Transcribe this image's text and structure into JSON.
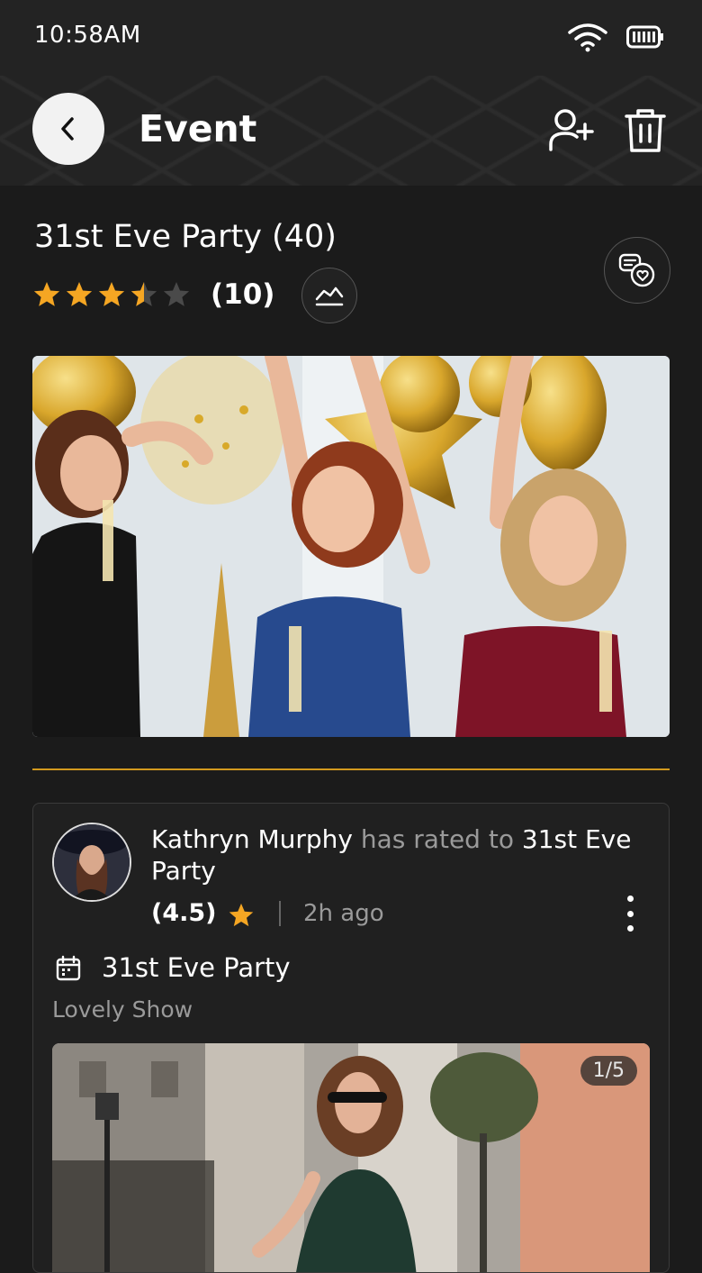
{
  "status_bar": {
    "time": "10:58AM"
  },
  "header": {
    "title": "Event"
  },
  "event": {
    "title": "31st Eve Party (40)",
    "rating": 3.5,
    "rating_count": "(10)"
  },
  "review": {
    "user_name": "Kathryn Murphy",
    "action_text": "has rated to",
    "target": "31st Eve Party",
    "score": "(4.5)",
    "time_ago": "2h ago",
    "event_name": "31st Eve Party",
    "comment": "Lovely Show",
    "photo_counter": "1/5"
  },
  "colors": {
    "accent": "#f5a623",
    "divider": "#d39a1e",
    "background": "#1b1b1b"
  }
}
